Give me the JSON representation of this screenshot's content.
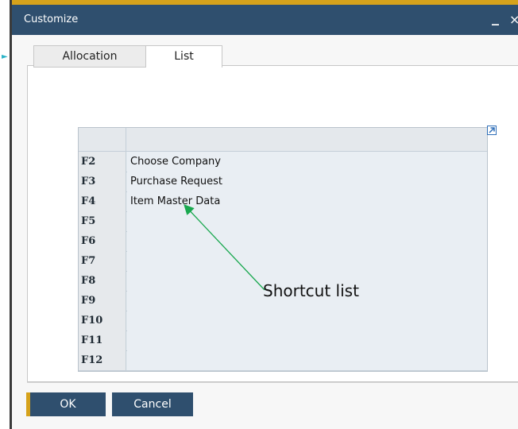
{
  "window": {
    "title": "Customize",
    "minimize_glyph": "_",
    "close_glyph": "×"
  },
  "tabs": [
    {
      "label": "Allocation"
    },
    {
      "label": "List"
    }
  ],
  "grid": {
    "header": {
      "key": "",
      "value": ""
    },
    "rows": [
      {
        "key": "F2",
        "value": "Choose Company"
      },
      {
        "key": "F3",
        "value": "Purchase Request"
      },
      {
        "key": "F4",
        "value": "Item Master Data"
      },
      {
        "key": "F5",
        "value": ""
      },
      {
        "key": "F6",
        "value": ""
      },
      {
        "key": "F7",
        "value": ""
      },
      {
        "key": "F8",
        "value": ""
      },
      {
        "key": "F9",
        "value": ""
      },
      {
        "key": "F10",
        "value": ""
      },
      {
        "key": "F11",
        "value": ""
      },
      {
        "key": "F12",
        "value": ""
      }
    ]
  },
  "annotation": {
    "text": "Shortcut list"
  },
  "buttons": {
    "ok_label": "OK",
    "cancel_label": "Cancel"
  },
  "colors": {
    "titlebar": "#2f4f6e",
    "accent": "#d6a21b",
    "annotation_arrow": "#1aa84f"
  }
}
